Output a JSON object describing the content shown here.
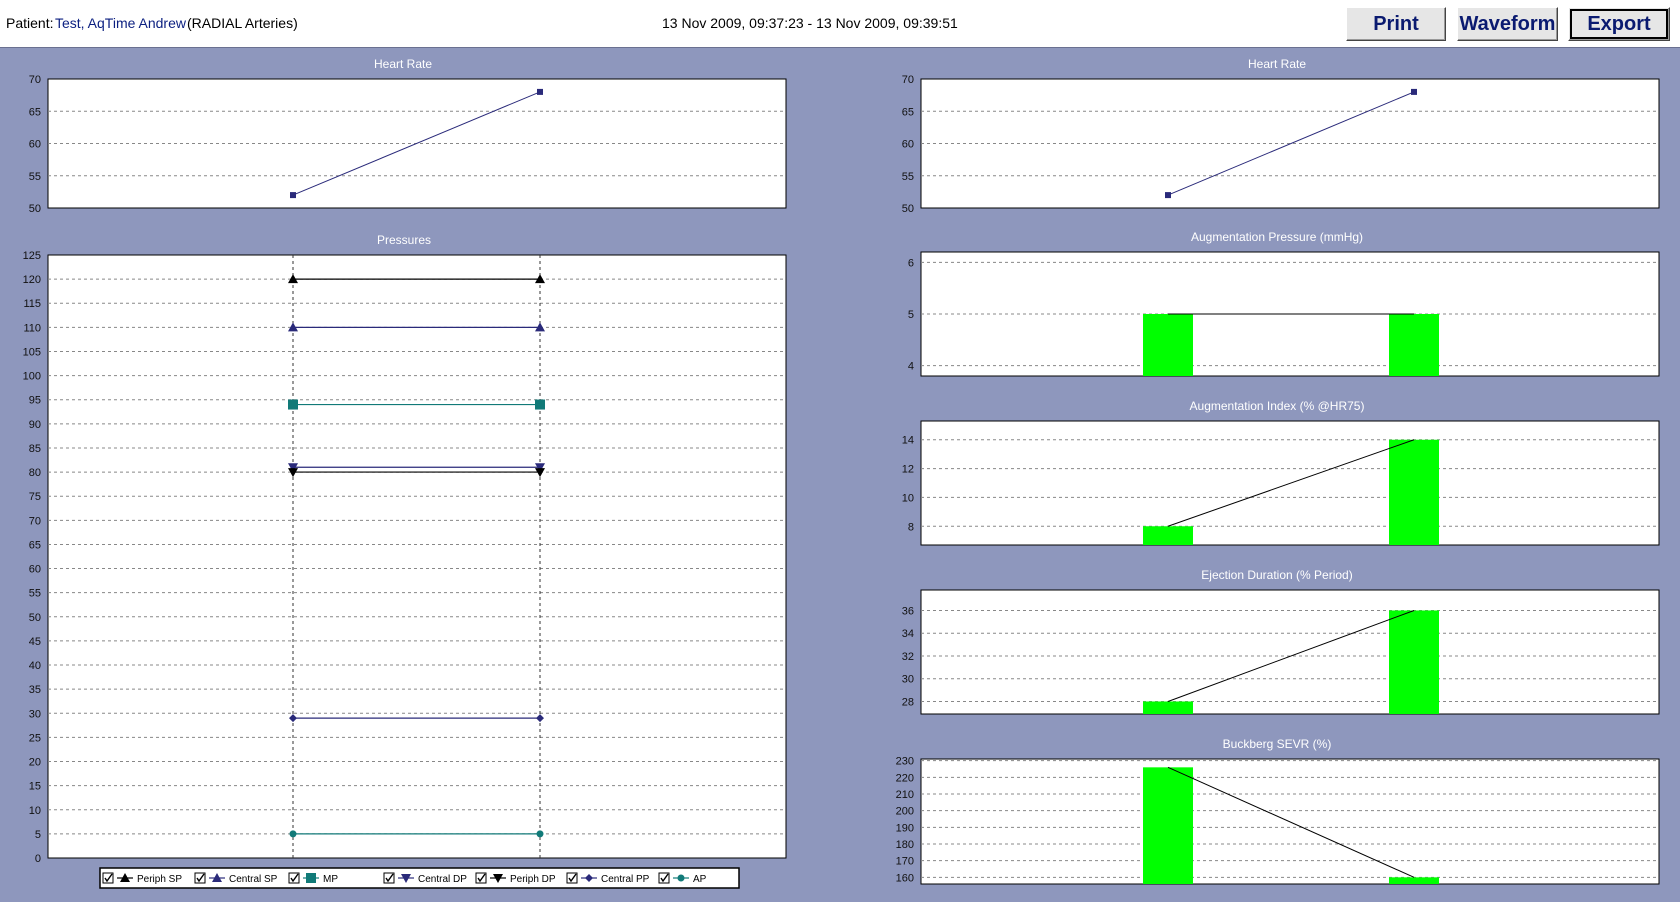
{
  "header": {
    "patient_label": "Patient:",
    "patient_name": "Test, AqTime Andrew",
    "artery": "(RADIAL Arteries)",
    "date_range": "13 Nov 2009, 09:37:23 - 13 Nov 2009, 09:39:51",
    "buttons": {
      "print": "Print",
      "waveform": "Waveform",
      "export": "Export"
    }
  },
  "colors": {
    "background": "#8e97bd",
    "bar": "#00ff00",
    "navy": "#2a2a7a",
    "teal": "#117a78"
  },
  "chart_data": [
    {
      "id": "hr_left",
      "type": "line",
      "title": "Heart Rate",
      "x": [
        1,
        2
      ],
      "ylim": [
        50,
        70
      ],
      "yticks": [
        50,
        55,
        60,
        65,
        70
      ],
      "series": [
        {
          "values": [
            52,
            68
          ]
        }
      ]
    },
    {
      "id": "pressures",
      "type": "line",
      "title": "Pressures",
      "x": [
        1,
        2
      ],
      "ylim": [
        0,
        125
      ],
      "yticks": [
        0,
        5,
        10,
        15,
        20,
        25,
        30,
        35,
        40,
        45,
        50,
        55,
        60,
        65,
        70,
        75,
        80,
        85,
        90,
        95,
        100,
        105,
        110,
        115,
        120,
        125
      ],
      "series": [
        {
          "name": "Periph SP",
          "values": [
            120,
            120
          ]
        },
        {
          "name": "Central SP",
          "values": [
            110,
            110
          ]
        },
        {
          "name": "MP",
          "values": [
            94,
            94
          ]
        },
        {
          "name": "Central DP",
          "values": [
            81,
            81
          ]
        },
        {
          "name": "Periph DP",
          "values": [
            80,
            80
          ]
        },
        {
          "name": "Central PP",
          "values": [
            29,
            29
          ]
        },
        {
          "name": "AP",
          "values": [
            5,
            5
          ]
        }
      ]
    },
    {
      "id": "hr_right",
      "type": "line",
      "title": "Heart Rate",
      "x": [
        1,
        2
      ],
      "ylim": [
        50,
        70
      ],
      "yticks": [
        50,
        55,
        60,
        65,
        70
      ],
      "series": [
        {
          "values": [
            52,
            68
          ]
        }
      ]
    },
    {
      "id": "aug_pressure",
      "type": "bar",
      "title": "Augmentation Pressure (mmHg)",
      "x": [
        1,
        2
      ],
      "ylim": [
        3.8,
        6.2
      ],
      "yticks": [
        4,
        5,
        6
      ],
      "series": [
        {
          "values": [
            5,
            5
          ]
        }
      ]
    },
    {
      "id": "aug_index",
      "type": "bar",
      "title": "Augmentation Index (% @HR75)",
      "x": [
        1,
        2
      ],
      "ylim": [
        6.7,
        15.3
      ],
      "yticks": [
        8,
        10,
        12,
        14
      ],
      "series": [
        {
          "values": [
            8,
            14
          ]
        }
      ]
    },
    {
      "id": "ejection",
      "type": "bar",
      "title": "Ejection Duration (% Period)",
      "x": [
        1,
        2
      ],
      "ylim": [
        26.9,
        37.8
      ],
      "yticks": [
        28,
        30,
        32,
        34,
        36
      ],
      "series": [
        {
          "values": [
            28,
            36
          ]
        }
      ]
    },
    {
      "id": "sevr",
      "type": "bar",
      "title": "Buckberg SEVR (%)",
      "x": [
        1,
        2
      ],
      "ylim": [
        156,
        231
      ],
      "yticks": [
        160,
        170,
        180,
        190,
        200,
        210,
        220,
        230
      ],
      "series": [
        {
          "values": [
            226,
            160
          ]
        }
      ]
    }
  ]
}
